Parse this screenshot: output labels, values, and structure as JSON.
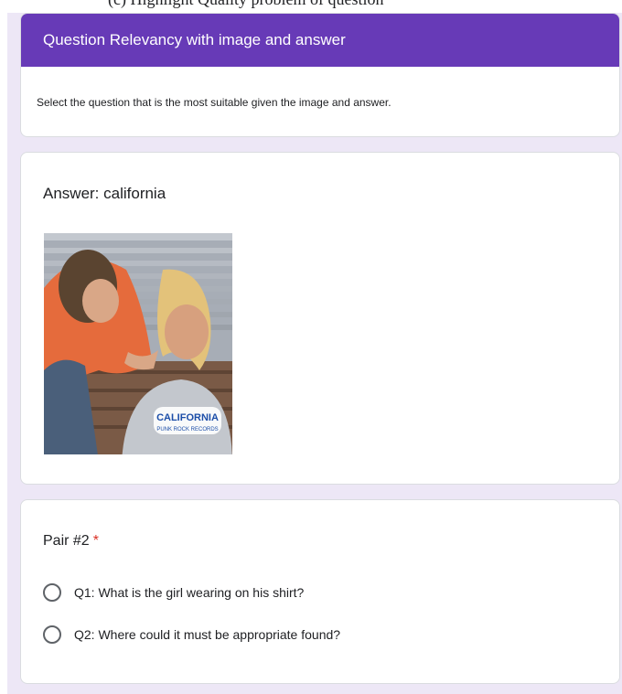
{
  "page_top_caption": "(c) Highlight Quality problem of question",
  "header": {
    "title": "Question Relevancy with image and answer",
    "description": "Select the question that is the most suitable given the image and answer."
  },
  "answer_card": {
    "title": "Answer: california",
    "image": {
      "shirt_text_line1": "CALIFORNIA",
      "shirt_text_line2": "PUNK ROCK RECORDS"
    }
  },
  "pair_card": {
    "title": "Pair #2",
    "required_marker": "*",
    "options": [
      {
        "label": "Q1: What is the girl wearing on his shirt?",
        "selected": false
      },
      {
        "label": "Q2: Where could it must be appropriate found?",
        "selected": false
      }
    ]
  },
  "colors": {
    "header_purple": "#673ab7",
    "page_background": "#ede7f6",
    "required_red": "#d93025"
  }
}
